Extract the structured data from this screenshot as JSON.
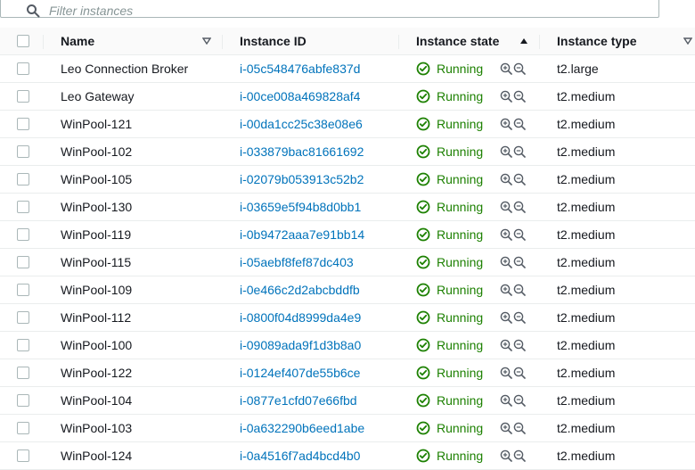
{
  "filter": {
    "placeholder": "Filter instances",
    "icon": "search-icon"
  },
  "columns": {
    "name": "Name",
    "instance_id": "Instance ID",
    "instance_state": "Instance state",
    "instance_type": "Instance type"
  },
  "sort": {
    "name": "caret-down-outline",
    "instance_state": "caret-up-filled",
    "instance_type": "caret-down-outline"
  },
  "rows": [
    {
      "name": "Leo Connection Broker",
      "id": "i-05c548476abfe837d",
      "state": "Running",
      "type": "t2.large"
    },
    {
      "name": "Leo Gateway",
      "id": "i-00ce008a469828af4",
      "state": "Running",
      "type": "t2.medium"
    },
    {
      "name": "WinPool-121",
      "id": "i-00da1cc25c38e08e6",
      "state": "Running",
      "type": "t2.medium"
    },
    {
      "name": "WinPool-102",
      "id": "i-033879bac81661692",
      "state": "Running",
      "type": "t2.medium"
    },
    {
      "name": "WinPool-105",
      "id": "i-02079b053913c52b2",
      "state": "Running",
      "type": "t2.medium"
    },
    {
      "name": "WinPool-130",
      "id": "i-03659e5f94b8d0bb1",
      "state": "Running",
      "type": "t2.medium"
    },
    {
      "name": "WinPool-119",
      "id": "i-0b9472aaa7e91bb14",
      "state": "Running",
      "type": "t2.medium"
    },
    {
      "name": "WinPool-115",
      "id": "i-05aebf8fef87dc403",
      "state": "Running",
      "type": "t2.medium"
    },
    {
      "name": "WinPool-109",
      "id": "i-0e466c2d2abcbddfb",
      "state": "Running",
      "type": "t2.medium"
    },
    {
      "name": "WinPool-112",
      "id": "i-0800f04d8999da4e9",
      "state": "Running",
      "type": "t2.medium"
    },
    {
      "name": "WinPool-100",
      "id": "i-09089ada9f1d3b8a0",
      "state": "Running",
      "type": "t2.medium"
    },
    {
      "name": "WinPool-122",
      "id": "i-0124ef407de55b6ce",
      "state": "Running",
      "type": "t2.medium"
    },
    {
      "name": "WinPool-104",
      "id": "i-0877e1cfd07e66fbd",
      "state": "Running",
      "type": "t2.medium"
    },
    {
      "name": "WinPool-103",
      "id": "i-0a632290b6eed1abe",
      "state": "Running",
      "type": "t2.medium"
    },
    {
      "name": "WinPool-124",
      "id": "i-0a4516f7ad4bcd4b0",
      "state": "Running",
      "type": "t2.medium"
    }
  ],
  "colors": {
    "link": "#0073bb",
    "running": "#1d8102",
    "border": "#eaeded",
    "header_bg": "#fafafa"
  }
}
